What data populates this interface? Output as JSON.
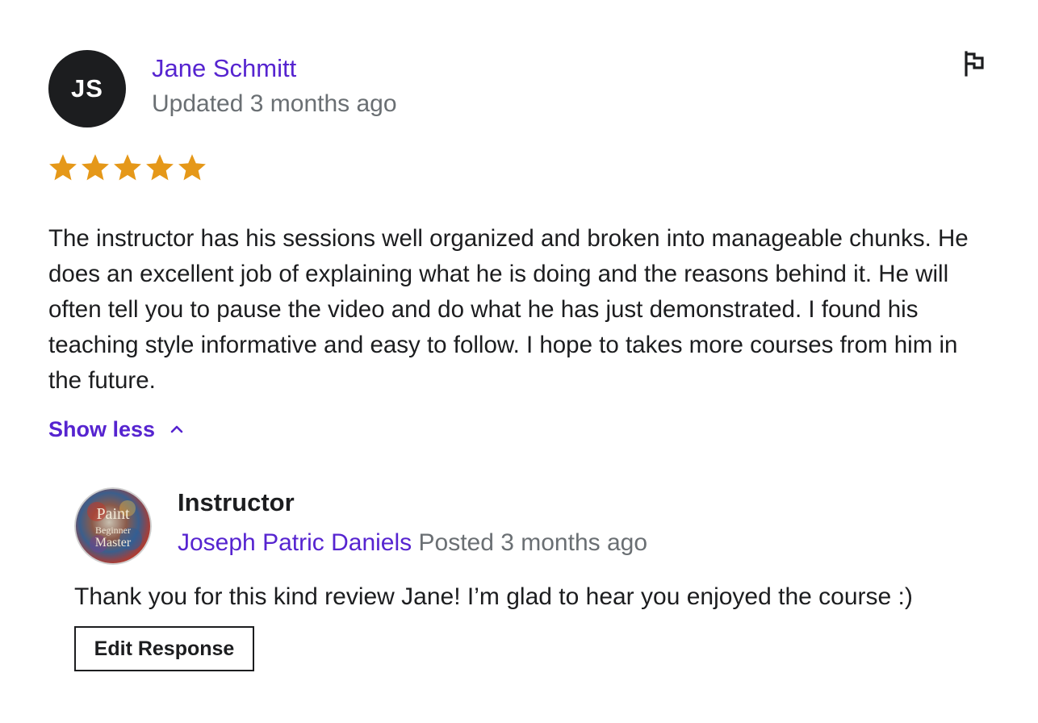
{
  "review": {
    "avatar_initials": "JS",
    "reviewer_name": "Jane Schmitt",
    "updated_text": "Updated 3 months ago",
    "rating": 5,
    "rating_max": 5,
    "star_color": "#e59819",
    "body": "The instructor has his sessions well organized and broken into manageable chunks. He does an excellent job of explaining what he is doing and the reasons behind it. He will often tell you to pause the video and do what he has just demonstrated. I found his teaching style informative and easy to follow. I hope to takes more courses from him in the future.",
    "show_less_label": "Show less",
    "flag_icon": "flag-icon"
  },
  "response": {
    "role_label": "Instructor",
    "instructor_name": "Joseph Patric Daniels",
    "posted_text": "Posted 3 months ago",
    "avatar_logo_text": [
      "Paint",
      "Beginner",
      "Master"
    ],
    "text": "Thank you for this kind review Jane! I’m glad to hear you enjoyed the course :)",
    "edit_button_label": "Edit Response"
  },
  "colors": {
    "link_purple": "#5624d0",
    "muted_gray": "#6a6f73",
    "text_dark": "#1c1d1f"
  }
}
